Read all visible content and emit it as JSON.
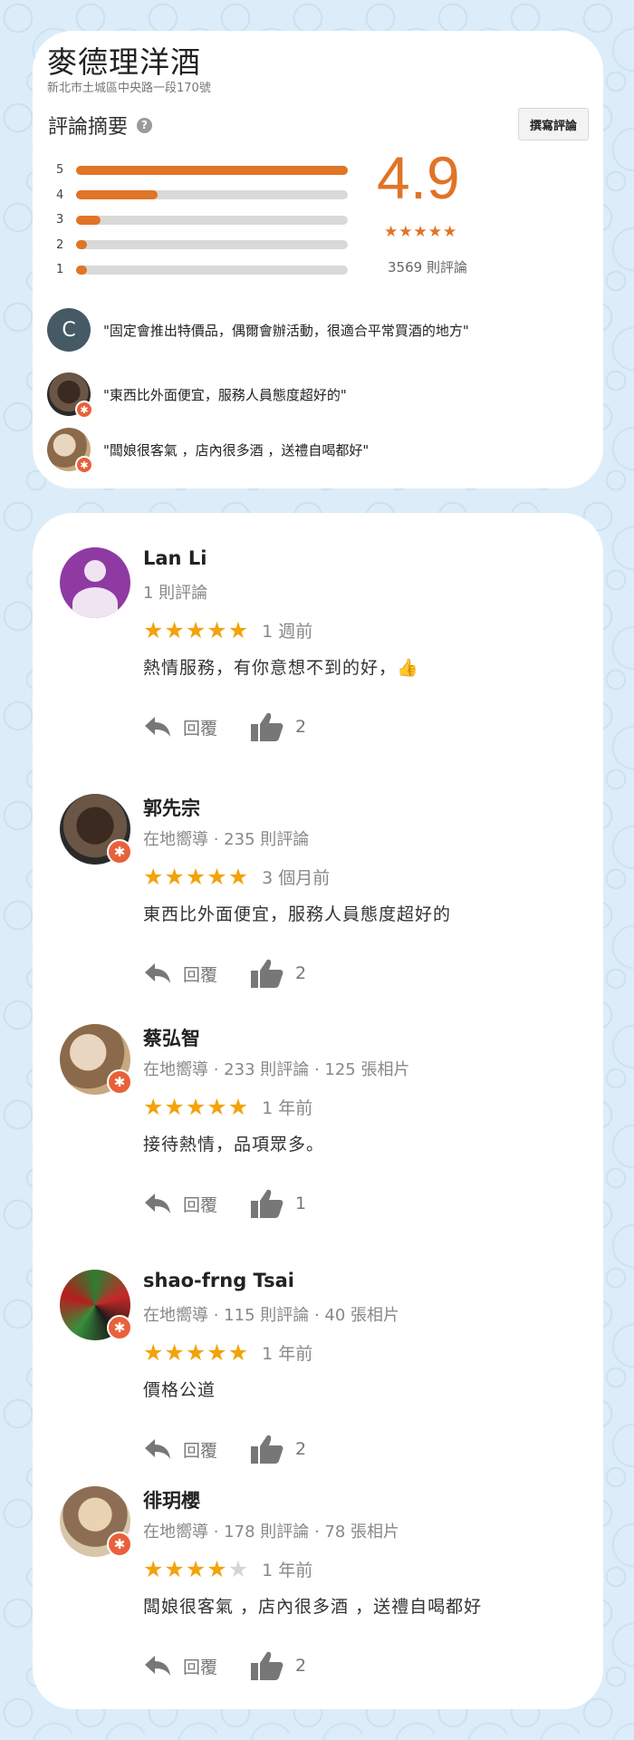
{
  "store": {
    "name": "麥德理洋酒",
    "address": "新北市土城區中央路一段170號"
  },
  "summary": {
    "heading": "評論摘要",
    "write_review_label": "撰寫評論",
    "rating": "4.9",
    "stars": "★★★★★",
    "review_count": "3569 則評論",
    "distribution": [
      {
        "label": "5",
        "fraction": 1.0
      },
      {
        "label": "4",
        "fraction": 0.3
      },
      {
        "label": "3",
        "fraction": 0.09
      },
      {
        "label": "2",
        "fraction": 0.03
      },
      {
        "label": "1",
        "fraction": 0.03
      }
    ],
    "snippets": [
      {
        "avatar_letter": "C",
        "text": "\"固定會推出特價品，偶爾會辦活動，很適合平常買酒的地方\""
      },
      {
        "text": "\"東西比外面便宜，服務人員態度超好的\""
      },
      {
        "text": "\"闆娘很客氣 ，店內很多酒 ，送禮自喝都好\""
      }
    ]
  },
  "reviews": [
    {
      "name": "Lan Li",
      "meta": "1 則評論",
      "rating": 5,
      "time": "1 週前",
      "text": "熱情服務，有你意想不到的好，👍",
      "reply_label": "回覆",
      "likes": "2"
    },
    {
      "name": "郭先宗",
      "meta": "在地嚮導 · 235 則評論",
      "rating": 5,
      "time": "3 個月前",
      "text": "東西比外面便宜，服務人員態度超好的",
      "reply_label": "回覆",
      "likes": "2"
    },
    {
      "name": "蔡弘智",
      "meta": "在地嚮導 · 233 則評論 · 125 張相片",
      "rating": 5,
      "time": "1 年前",
      "text": "接待熱情，品項眾多。",
      "reply_label": "回覆",
      "likes": "1"
    },
    {
      "name": "shao-frng Tsai",
      "meta": "在地嚮導 · 115 則評論 · 40 張相片",
      "rating": 5,
      "time": "1 年前",
      "text": "價格公道",
      "reply_label": "回覆",
      "likes": "2"
    },
    {
      "name": "徘玥櫻",
      "meta": "在地嚮導 · 178 則評論 · 78 張相片",
      "rating": 4,
      "time": "1 年前",
      "text": "闆娘很客氣 ，店內很多酒 ，送禮自喝都好",
      "reply_label": "回覆",
      "likes": "2"
    }
  ],
  "colors": {
    "accent": "#e07427",
    "star": "#f2a30b",
    "background": "#dcedf9"
  },
  "icons": [
    "help-icon",
    "reply-icon",
    "thumbs-up-icon",
    "local-guide-badge-icon"
  ]
}
